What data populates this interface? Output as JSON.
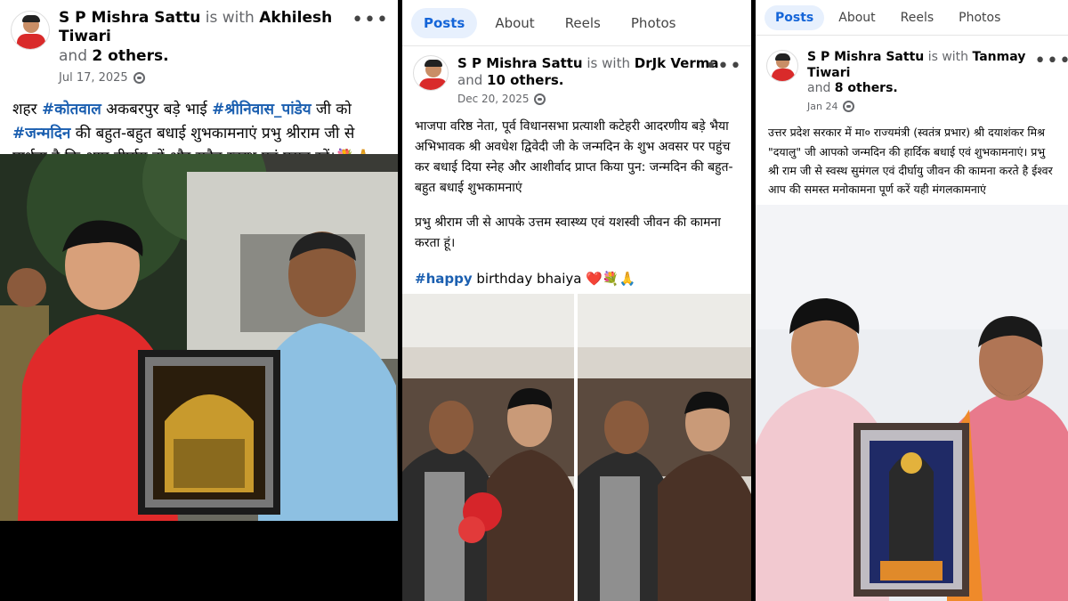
{
  "panels": [
    {
      "author": "S P Mishra Sattu",
      "with_word": "is with",
      "tagged": "Akhilesh Tiwari",
      "and_word": "and",
      "others": "2 others.",
      "date": "Jul 17, 2025",
      "text_parts": {
        "t1": "शहर ",
        "h1": "#कोतवाल",
        "t2": " अकबरपुर बड़े भाई ",
        "h2": "#श्रीनिवास_पांडेय",
        "t3": " जी को ",
        "h3": "#जन्मदिन",
        "t4": " की बहुत-बहुत बधाई शुभकामनाएं  प्रभु श्रीराम जी से प्रार्थना है कि आप दीर्घायु हों और सदैव स्वस्थ एवं प्रसन्न रहें।💐🙏"
      }
    },
    {
      "tabs": [
        "Posts",
        "About",
        "Reels",
        "Photos"
      ],
      "author": "S P Mishra Sattu",
      "with_word": "is with",
      "tagged": "DrJk Verma",
      "and_word": "and",
      "others": "10 others.",
      "date": "Dec 20, 2025",
      "para1": "भाजपा वरिष्ठ नेता, पूर्व विधानसभा प्रत्याशी कटेहरी  आदरणीय बड़े भैया अभिभावक श्री अवधेश द्विवेदी जी के जन्मदिन के शुभ अवसर पर पहुंच कर बधाई दिया स्नेह और आशीर्वाद प्राप्त किया पुन: जन्मदिन  की बहुत-बहुत बधाई शुभकामनाएं",
      "para2": "प्रभु श्रीराम जी से आपके उत्तम स्वास्थ्य एवं यशस्वी जीवन की कामना करता हूं।",
      "hashtag": "#happy",
      "para3_rest": " birthday bhaiya ❤️💐🙏"
    },
    {
      "tabs": [
        "Posts",
        "About",
        "Reels",
        "Photos"
      ],
      "author": "S P Mishra Sattu",
      "with_word": "is with",
      "tagged": "Tanmay Tiwari",
      "and_word": "and",
      "others": "8 others.",
      "date": "Jan 24",
      "text": "उत्तर प्रदेश सरकार में मा० राज्यमंत्री (स्वतंत्र प्रभार) श्री दयाशंकर मिश्र \"दयालु\" जी आपको जन्मदिन की हार्दिक बधाई एवं शुभकामनाएं। प्रभु श्री राम जी से स्वस्थ सुमंगल एवं दीर्घायु जीवन की कामना करते है ईश्वर आप की समस्त मनोकामना पूर्ण करें यही मंगलकामनाएं"
    }
  ],
  "icons": {
    "more": "more-options-icon",
    "privacy": "globe-icon"
  },
  "colors": {
    "accent": "#1565d8",
    "hashtag": "#1b5fb0",
    "tab_active_bg": "#e7f0fd"
  }
}
